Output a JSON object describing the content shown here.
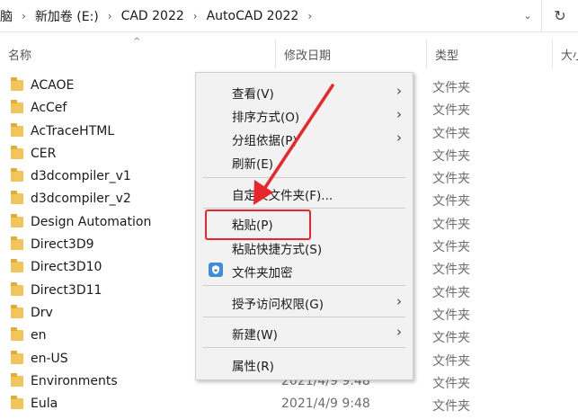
{
  "address_bar": {
    "crumbs": [
      "脑",
      "新加卷 (E:)",
      "CAD 2022",
      "AutoCAD 2022"
    ],
    "separator": "›",
    "dropdown_glyph": "⌄",
    "refresh_glyph": "↻"
  },
  "columns": {
    "name": "名称",
    "date": "修改日期",
    "type": "类型",
    "size": "大小",
    "sort_glyph": "^"
  },
  "files": [
    {
      "name": "ACAOE",
      "date": "",
      "type": "文件夹"
    },
    {
      "name": "AcCef",
      "date": "",
      "type": "文件夹"
    },
    {
      "name": "AcTraceHTML",
      "date": "",
      "type": "文件夹"
    },
    {
      "name": "CER",
      "date": "",
      "type": "文件夹"
    },
    {
      "name": "d3dcompiler_v1",
      "date": "",
      "type": "文件夹"
    },
    {
      "name": "d3dcompiler_v2",
      "date": "",
      "type": "文件夹"
    },
    {
      "name": "Design Automation",
      "date": "",
      "type": "文件夹"
    },
    {
      "name": "Direct3D9",
      "date": "",
      "type": "文件夹"
    },
    {
      "name": "Direct3D10",
      "date": "",
      "type": "文件夹"
    },
    {
      "name": "Direct3D11",
      "date": "",
      "type": "文件夹"
    },
    {
      "name": "Drv",
      "date": "",
      "type": "文件夹"
    },
    {
      "name": "en",
      "date": "",
      "type": "文件夹"
    },
    {
      "name": "en-US",
      "date": "",
      "type": "文件夹"
    },
    {
      "name": "Environments",
      "date": "2021/4/9 9:48",
      "type": "文件夹"
    },
    {
      "name": "Eula",
      "date": "2021/4/9 9:48",
      "type": "文件夹"
    }
  ],
  "context_menu": {
    "chevron_glyph": "›",
    "items": {
      "view": "查看(V)",
      "sort": "排序方式(O)",
      "group": "分组依据(P)",
      "refresh": "刷新(E)",
      "customize": "自定义文件夹(F)...",
      "paste": "粘贴(P)",
      "paste_shortcut": "粘贴快捷方式(S)",
      "encrypt": "文件夹加密",
      "access": "授予访问权限(G)",
      "new": "新建(W)",
      "properties": "属性(R)"
    }
  },
  "colors": {
    "annotation_red": "#e8262b",
    "folder_yellow": "#f2c55c",
    "menu_bg": "#f2f2f2"
  }
}
